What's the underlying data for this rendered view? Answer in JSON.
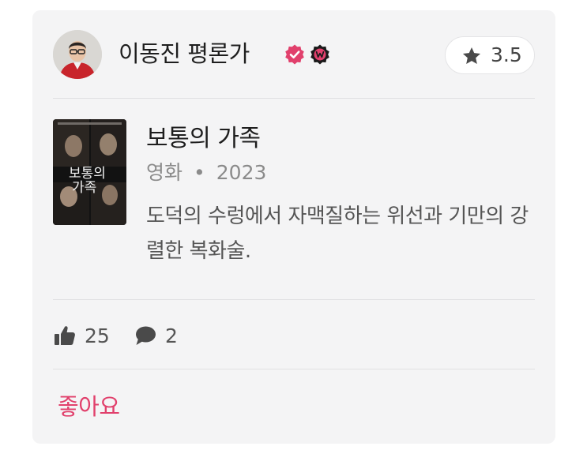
{
  "review": {
    "author_name": "이동진 평론가",
    "badges": [
      "verified-check-icon",
      "watcha-w-icon"
    ],
    "rating": "3.5",
    "movie": {
      "title": "보통의 가족",
      "category": "영화",
      "separator": "•",
      "year": "2023"
    },
    "comment": "도덕의 수렁에서 자맥질하는 위선과 기만의 강렬한 복화술.",
    "likes": "25",
    "comments": "2",
    "like_action_label": "좋아요"
  },
  "colors": {
    "card_bg": "#f4f4f5",
    "accent_pink": "#e1406c",
    "text_primary": "#1e1e1e",
    "text_secondary": "#8b8b8b"
  }
}
